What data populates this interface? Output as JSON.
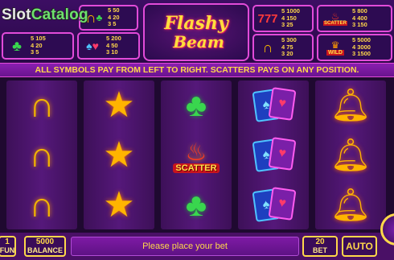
{
  "brand": {
    "part1": "Slot",
    "part2": "Catalog"
  },
  "logo": {
    "line1": "Flashy",
    "line2": "Beam"
  },
  "paytable": {
    "horseshoe_club": {
      "icon": "horseshoe-icon",
      "values": [
        "5 50",
        "4 20",
        "3 5"
      ]
    },
    "club": {
      "icon": "club-icon",
      "values": [
        "5 105",
        "4 20",
        "3 5"
      ]
    },
    "cards": {
      "icon": "cards-icon",
      "values": [
        "5 200",
        "4 50",
        "3 10"
      ]
    },
    "sevens": {
      "icon": "seven-icon",
      "values": [
        "5 1000",
        "4 150",
        "3 25"
      ]
    },
    "horseshoe": {
      "icon": "horseshoe-icon",
      "values": [
        "5 300",
        "4 75",
        "3 20"
      ]
    },
    "scatter": {
      "label": "SCATTER",
      "values": [
        "5 800",
        "4 400",
        "3 150"
      ]
    },
    "wild": {
      "label": "WILD",
      "values": [
        "5 5000",
        "4 3000",
        "3 1500"
      ]
    }
  },
  "rules": "ALL SYMBOLS PAY FROM LEFT TO RIGHT. SCATTERS PAYS ON ANY POSITION.",
  "reels": [
    [
      "horseshoe",
      "horseshoe",
      "horseshoe"
    ],
    [
      "star",
      "star",
      "star"
    ],
    [
      "club",
      "scatter",
      "club"
    ],
    [
      "cards",
      "cards",
      "cards"
    ],
    [
      "bell",
      "bell",
      "bell"
    ]
  ],
  "scatter_label": "SCATTER",
  "bottom": {
    "fun_value": "1",
    "fun_label": "FUN",
    "balance_value": "5000",
    "balance_label": "BALANCE",
    "message": "Please place your bet",
    "bet_value": "20",
    "bet_label": "BET",
    "auto_label": "AUTO"
  }
}
